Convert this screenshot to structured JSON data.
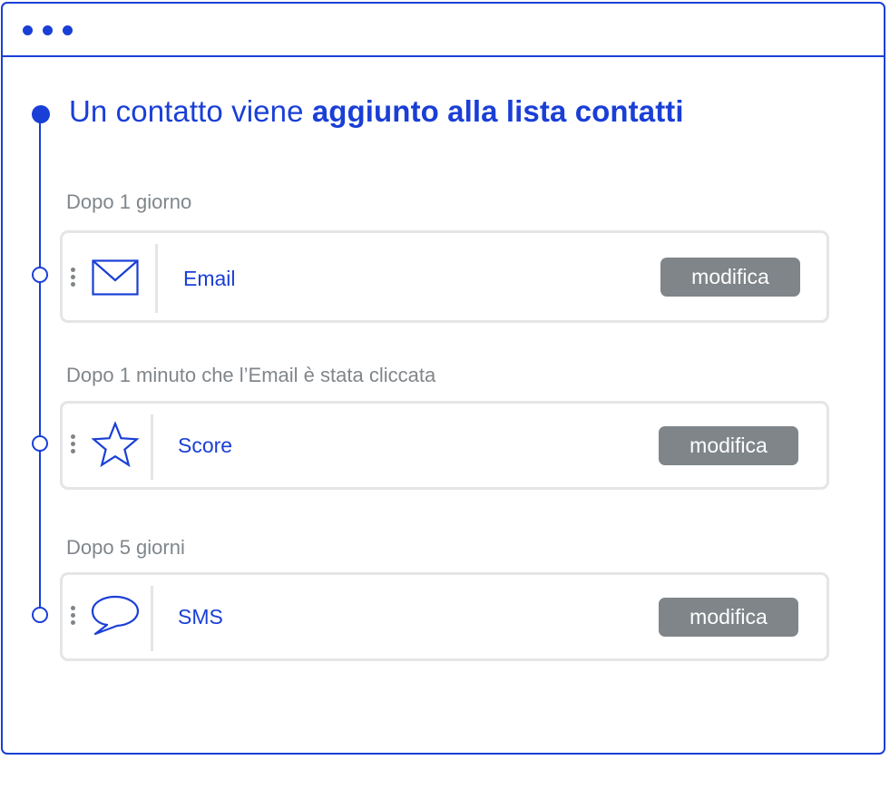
{
  "trigger": {
    "text_regular": "Un contatto viene ",
    "text_bold": "aggiunto alla lista contatti"
  },
  "steps": [
    {
      "delay": "Dopo 1 giorno",
      "icon": "envelope-icon",
      "label": "Email",
      "button": "modifica"
    },
    {
      "delay": "Dopo 1 minuto che l’Email è stata cliccata",
      "icon": "star-icon",
      "label": "Score",
      "button": "modifica"
    },
    {
      "delay": "Dopo 5 giorni",
      "icon": "speech-bubble-icon",
      "label": "SMS",
      "button": "modifica"
    }
  ],
  "colors": {
    "accent": "#1a3fd6",
    "muted_text": "#80868b",
    "button_bg": "#7f8589",
    "card_border": "#e3e5e6"
  }
}
